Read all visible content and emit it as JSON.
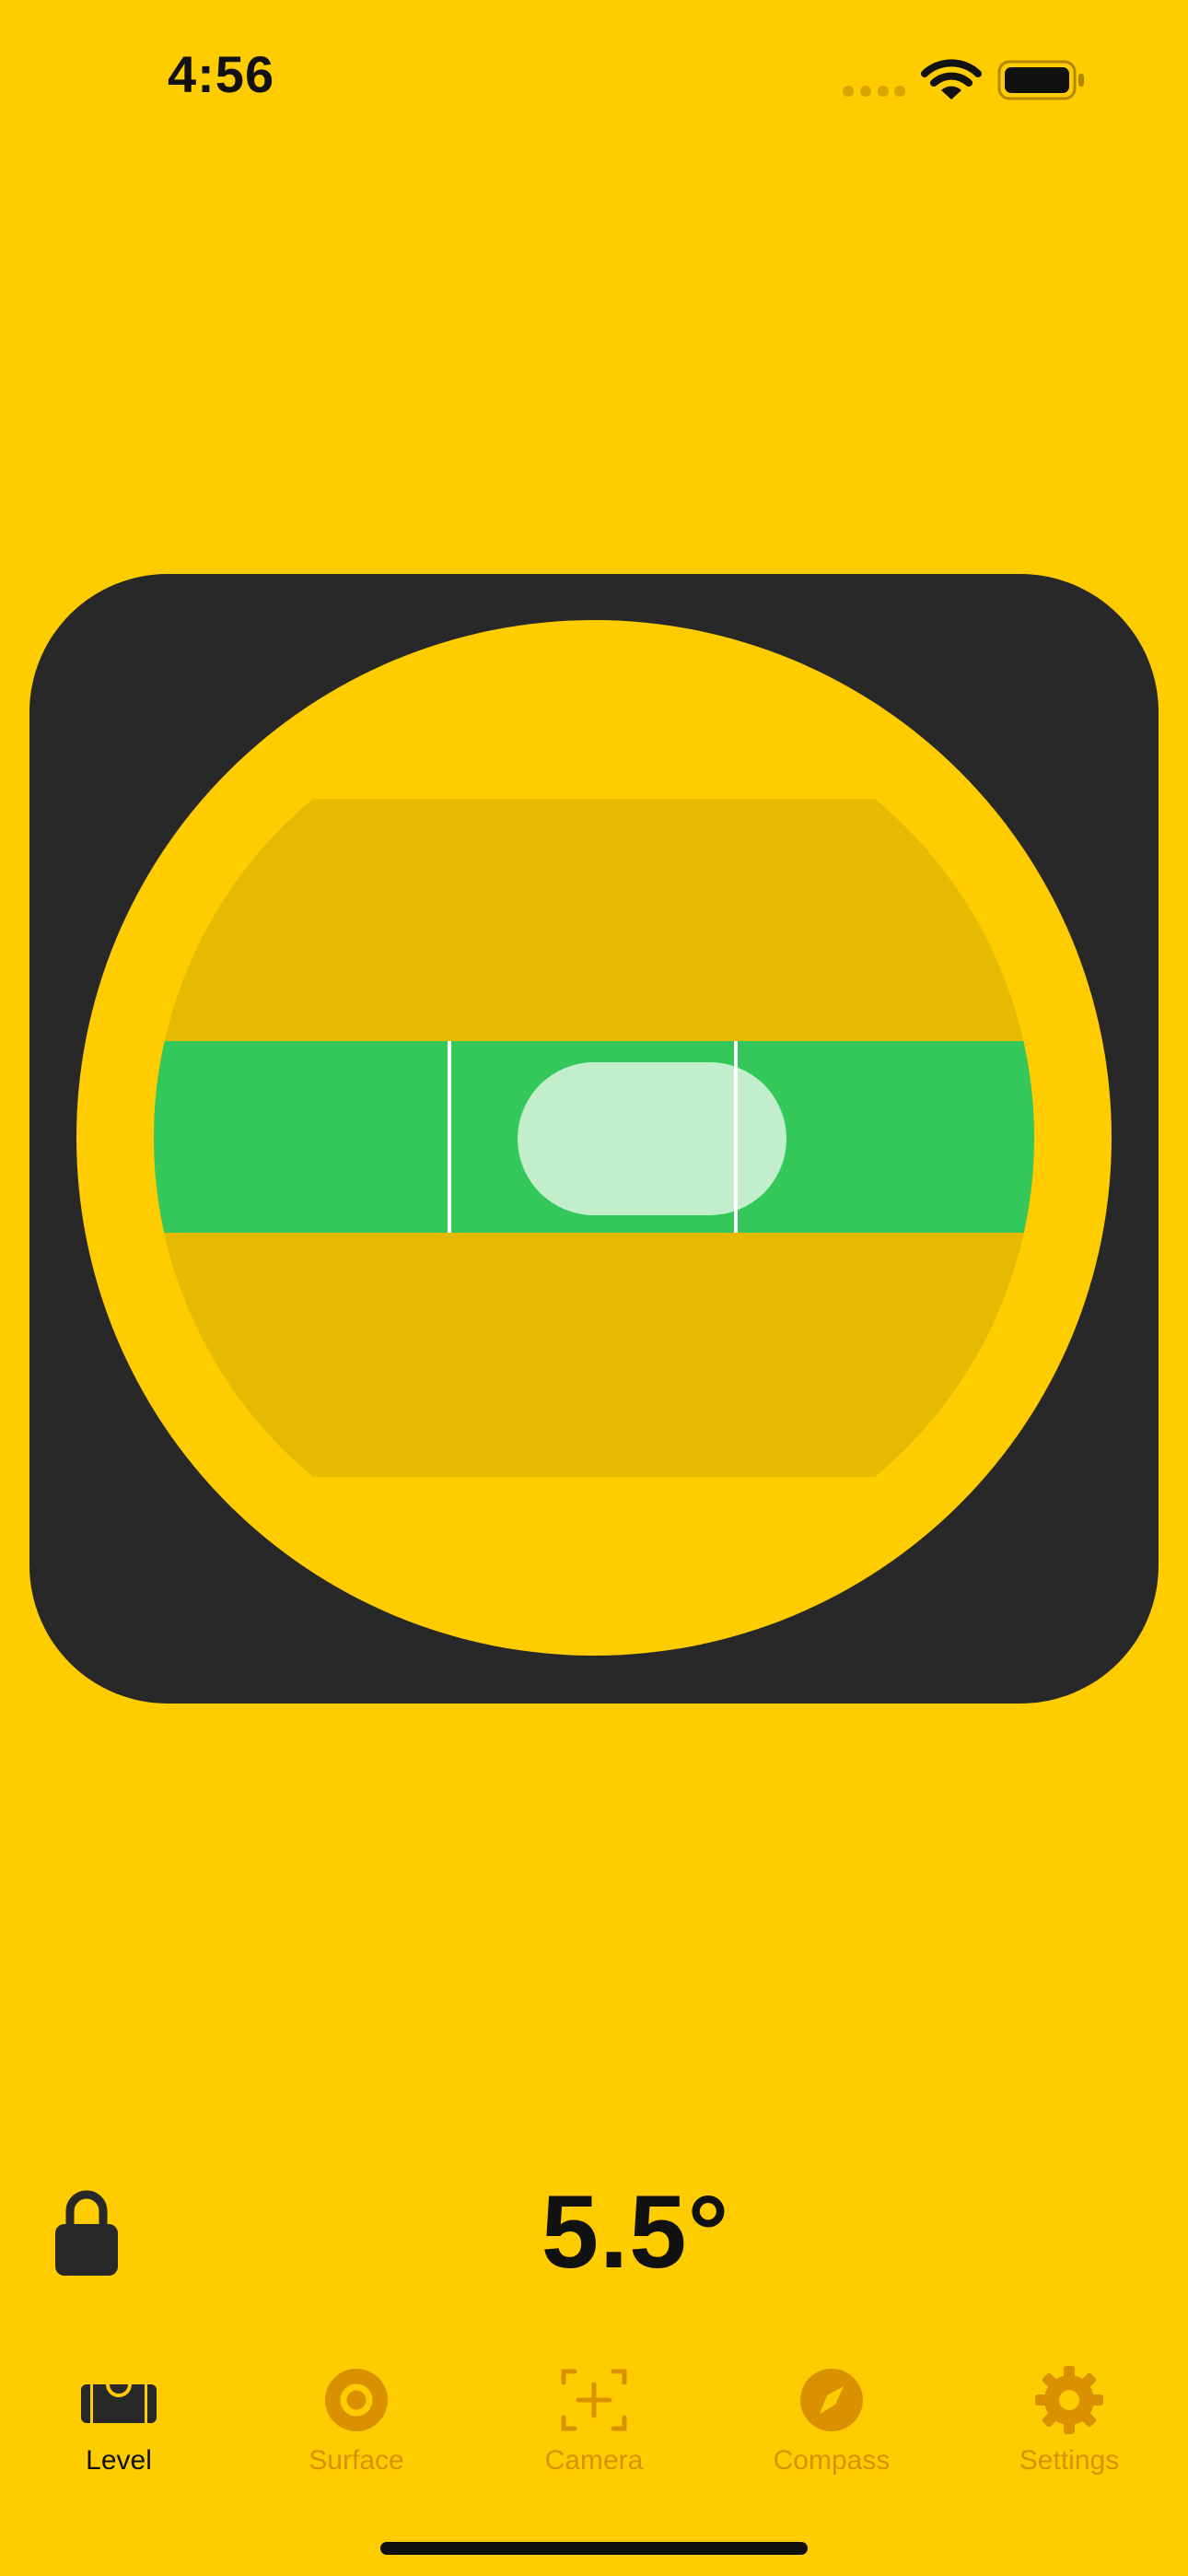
{
  "status_bar": {
    "time": "4:56",
    "icons": [
      "signal-dots-icon",
      "wifi-icon",
      "battery-icon"
    ]
  },
  "level": {
    "mode": "horizontal bubble level",
    "bubble_offset_fraction": 0.13
  },
  "readout": {
    "angle": "5.5°",
    "lock_icon": "lock-icon"
  },
  "tabs": [
    {
      "label": "Level",
      "icon": "level-icon",
      "active": true
    },
    {
      "label": "Surface",
      "icon": "surface-icon",
      "active": false
    },
    {
      "label": "Camera",
      "icon": "camera-icon",
      "active": false
    },
    {
      "label": "Compass",
      "icon": "compass-icon",
      "active": false
    },
    {
      "label": "Settings",
      "icon": "settings-icon",
      "active": false
    }
  ],
  "colors": {
    "background": "#FFCC00",
    "frame": "#282828",
    "vial_shade": "#E6BA00",
    "liquid": "#34C759",
    "bubble": "#C2EECC",
    "inactive_tab": "#D99100",
    "text": "#111111"
  }
}
